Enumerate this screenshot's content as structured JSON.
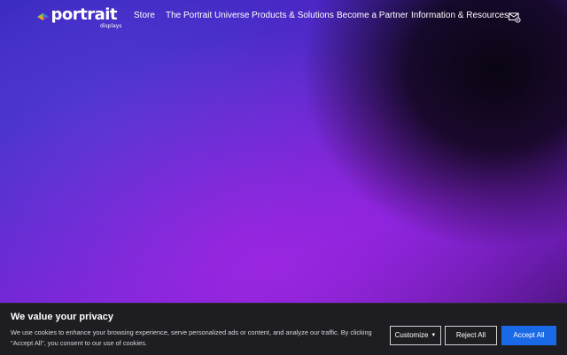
{
  "brand": {
    "name": "portrait",
    "subtitle": "displays",
    "colors": {
      "accent_green": "#8bc63f",
      "accent_blue": "#2f7fd6",
      "accent_orange": "#f2a41c",
      "accent_purple": "#7a3ec4"
    }
  },
  "nav": {
    "items": [
      {
        "label": "Store"
      },
      {
        "label": "The Portrait Universe"
      },
      {
        "label": "Products & Solutions"
      },
      {
        "label": "Become a Partner"
      },
      {
        "label": "Information & Resources"
      }
    ],
    "contact_icon": "mail-gear-icon"
  },
  "cookie_banner": {
    "title": "We value your privacy",
    "text": "We use cookies to enhance your browsing experience, serve personalized ads or content, and analyze our traffic. By clicking \"Accept All\", you consent to our use of cookies.",
    "customize_label": "Customize",
    "reject_label": "Reject All",
    "accept_label": "Accept All",
    "colors": {
      "background": "#1e1e22",
      "accept": "#1a6ae8"
    }
  }
}
